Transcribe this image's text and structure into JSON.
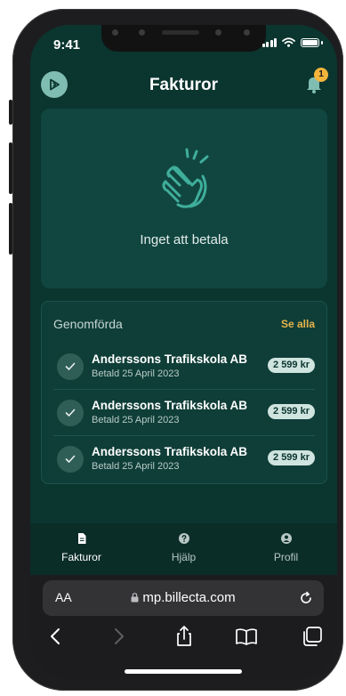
{
  "status": {
    "time": "9:41"
  },
  "header": {
    "title": "Fakturor",
    "notification_count": "1"
  },
  "empty_state": {
    "message": "Inget att betala"
  },
  "completed": {
    "title": "Genomförda",
    "see_all": "Se alla",
    "items": [
      {
        "company": "Anderssons Trafikskola AB",
        "status": "Betald 25 April 2023",
        "amount": "2 599 kr"
      },
      {
        "company": "Anderssons Trafikskola AB",
        "status": "Betald 25 April 2023",
        "amount": "2 599 kr"
      },
      {
        "company": "Anderssons Trafikskola AB",
        "status": "Betald 25 April 2023",
        "amount": "2 599 kr"
      }
    ]
  },
  "tabbar": {
    "active_color": "#ffffff",
    "inactive_color": "#b7c7c4",
    "tabs": [
      {
        "label": "Fakturor",
        "icon": "document-icon",
        "active": true
      },
      {
        "label": "Hjälp",
        "icon": "help-icon",
        "active": false
      },
      {
        "label": "Profil",
        "icon": "profile-icon",
        "active": false
      }
    ]
  },
  "browser": {
    "text_size_label": "AA",
    "url": "mp.billecta.com"
  },
  "colors": {
    "background": "#0b352f",
    "card": "#114640",
    "accent": "#e7b44a",
    "badge": "#f2b43a",
    "amount_pill": "#cfe4df"
  }
}
